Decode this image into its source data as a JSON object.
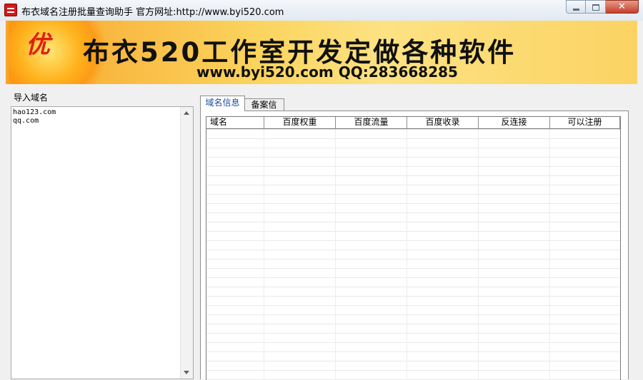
{
  "window": {
    "title": "布衣域名注册批量查询助手  官方网址:http://www.byi520.com",
    "close_glyph": "✕"
  },
  "banner": {
    "badge_char": "优",
    "title": "布衣520工作室开发定做各种软件",
    "subtitle": "www.byi520.com QQ:283668285"
  },
  "import": {
    "label": "导入域名",
    "text": "hao123.com\nqq.com"
  },
  "tabs": [
    {
      "label": "域名信息",
      "active": true
    },
    {
      "label": "备案信息",
      "active": false
    }
  ],
  "table": {
    "columns": [
      "域名",
      "百度权重",
      "百度流量",
      "百度收录",
      "反连接",
      "可以注册"
    ],
    "rows": []
  },
  "icons": {
    "app": "app-icon",
    "minimize": "minimize-icon",
    "maximize": "maximize-icon",
    "close": "close-icon",
    "scroll_up": "scroll-up-arrow-icon",
    "scroll_down": "scroll-down-arrow-icon"
  },
  "colors": {
    "banner_orange": "#f7a52c",
    "banner_yellow": "#fde283",
    "close_red": "#c53f2b",
    "active_tab_text": "#1b4d9e"
  }
}
